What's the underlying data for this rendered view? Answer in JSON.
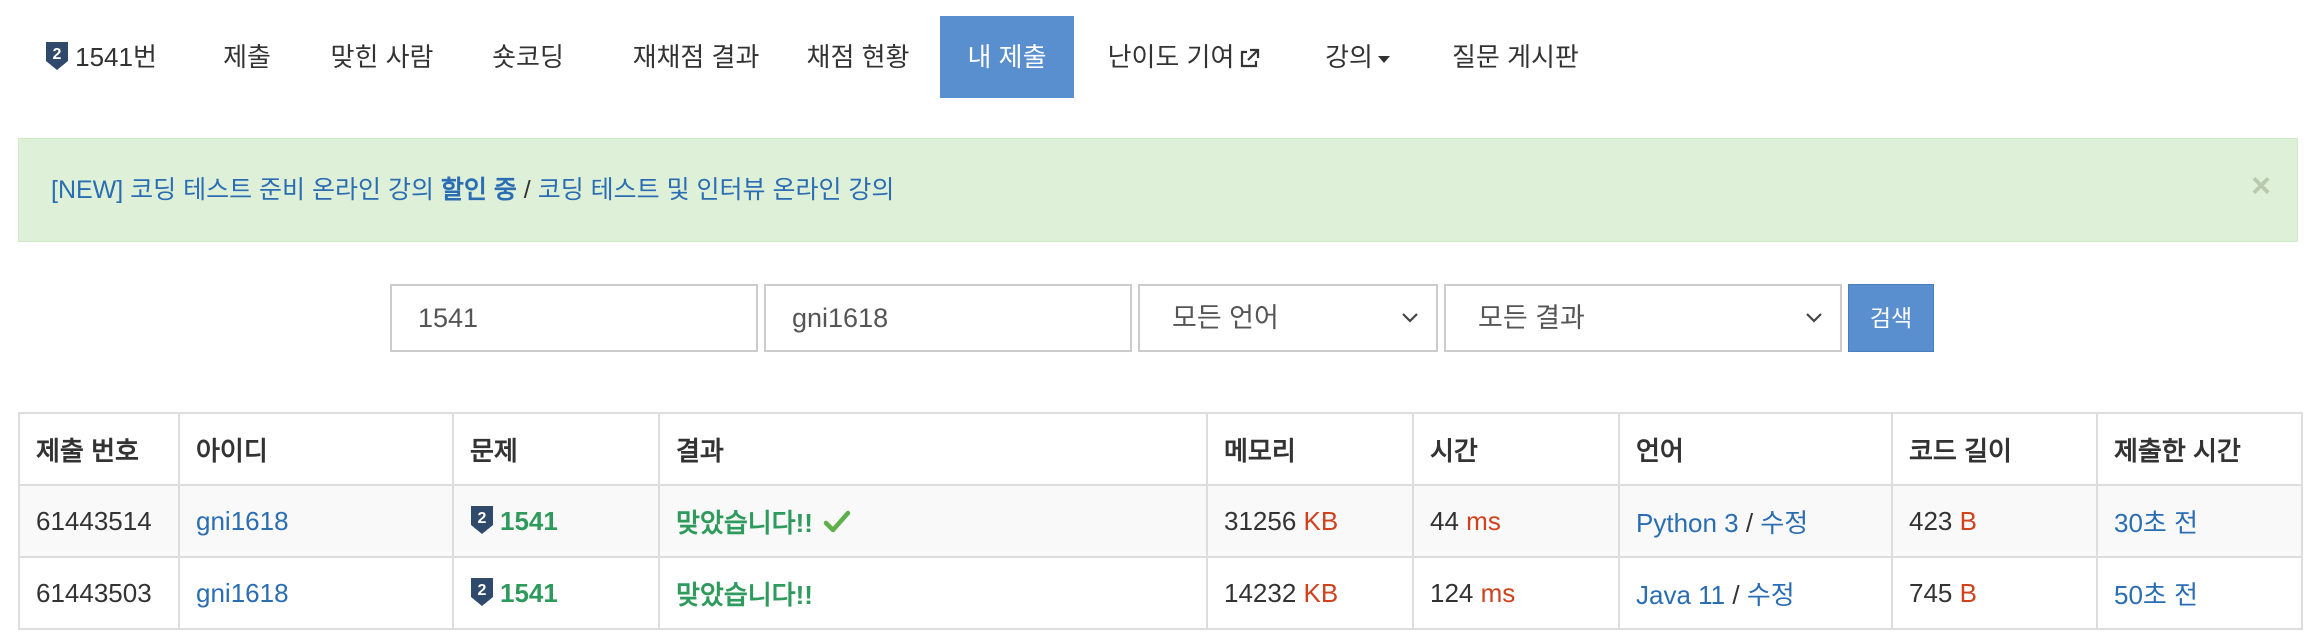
{
  "nav": {
    "items": [
      {
        "label": "1541번",
        "badge": "2"
      },
      {
        "label": "제출"
      },
      {
        "label": "맞힌 사람"
      },
      {
        "label": "숏코딩"
      },
      {
        "label": "재채점 결과"
      },
      {
        "label": "채점 현황"
      },
      {
        "label": "내 제출",
        "active": true
      },
      {
        "label": "난이도 기여",
        "icon": "external-link-icon"
      },
      {
        "label": "강의",
        "icon": "caret-down-icon"
      },
      {
        "label": "질문 게시판"
      }
    ]
  },
  "alert": {
    "prefix": "[NEW] 코딩 테스트 준비 온라인 강의 ",
    "bold": "할인 중",
    "separator": " / ",
    "link2": "코딩 테스트 및 인터뷰 온라인 강의",
    "close": "×"
  },
  "search": {
    "problem_value": "1541",
    "user_value": "gni1618",
    "language_selected": "모든 언어",
    "result_selected": "모든 결과",
    "button_label": "검색"
  },
  "table": {
    "headers": [
      "제출 번호",
      "아이디",
      "문제",
      "결과",
      "메모리",
      "시간",
      "언어",
      "코드 길이",
      "제출한 시간"
    ],
    "rows": [
      {
        "id": "61443514",
        "user": "gni1618",
        "badge": "2",
        "problem": "1541",
        "result": "맞았습니다!!",
        "check": true,
        "memory": "31256",
        "memory_unit": "KB",
        "time": "44",
        "time_unit": "ms",
        "language": "Python 3",
        "lang_sep": " / ",
        "edit": "수정",
        "length": "423",
        "length_unit": "B",
        "submitted": "30초 전"
      },
      {
        "id": "61443503",
        "user": "gni1618",
        "badge": "2",
        "problem": "1541",
        "result": "맞았습니다!!",
        "check": false,
        "memory": "14232",
        "memory_unit": "KB",
        "time": "124",
        "time_unit": "ms",
        "language": "Java 11",
        "lang_sep": " / ",
        "edit": "수정",
        "length": "745",
        "length_unit": "B",
        "submitted": "50초 전"
      }
    ]
  },
  "colors": {
    "accent": "#5a8fcf",
    "link": "#2a6db3",
    "accepted": "#2e9a5c",
    "unit": "#d0411e",
    "alert_bg": "#dff0d8",
    "level_badge": "#2f4a6a"
  }
}
